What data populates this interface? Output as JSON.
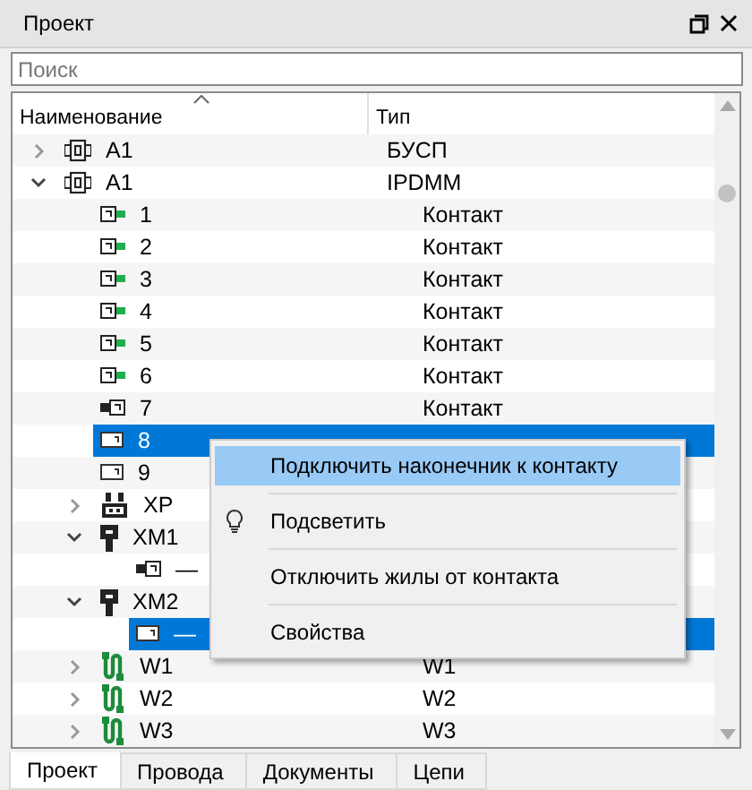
{
  "panel": {
    "title": "Проект"
  },
  "search": {
    "placeholder": "Поиск"
  },
  "columns": [
    "Наименование",
    "Тип"
  ],
  "rows": [
    {
      "name": "A1",
      "type": "БУСП",
      "kind": "device",
      "expanded": false,
      "selected": false
    },
    {
      "name": "A1",
      "type": "IPDMM",
      "kind": "device",
      "expanded": true,
      "selected": false,
      "children": [
        {
          "name": "1",
          "type": "Контакт",
          "kind": "contact-linked",
          "selected": false
        },
        {
          "name": "2",
          "type": "Контакт",
          "kind": "contact-linked",
          "selected": false
        },
        {
          "name": "3",
          "type": "Контакт",
          "kind": "contact-linked",
          "selected": false
        },
        {
          "name": "4",
          "type": "Контакт",
          "kind": "contact-linked",
          "selected": false
        },
        {
          "name": "5",
          "type": "Контакт",
          "kind": "contact-linked",
          "selected": false
        },
        {
          "name": "6",
          "type": "Контакт",
          "kind": "contact-linked",
          "selected": false
        },
        {
          "name": "7",
          "type": "Контакт",
          "kind": "contact-plugged",
          "selected": false
        },
        {
          "name": "8",
          "kind": "contact",
          "selected": true
        },
        {
          "name": "9",
          "kind": "contact",
          "selected": false
        },
        {
          "name": "XP",
          "kind": "connector",
          "expanded": false,
          "selected": false
        },
        {
          "name": "XM1",
          "kind": "plug",
          "expanded": true,
          "selected": false,
          "children": [
            {
              "name": "—",
              "kind": "contact-plugged",
              "selected": false
            }
          ]
        },
        {
          "name": "XM2",
          "kind": "plug",
          "expanded": true,
          "selected": false,
          "children": [
            {
              "name": "—",
              "kind": "contact",
              "selected": true
            }
          ]
        },
        {
          "name": "W1",
          "type": "W1",
          "kind": "cable",
          "expanded": false,
          "selected": false
        },
        {
          "name": "W2",
          "type": "W2",
          "kind": "cable",
          "expanded": false,
          "selected": false
        },
        {
          "name": "W3",
          "type": "W3",
          "kind": "cable",
          "expanded": false,
          "selected": false
        }
      ]
    }
  ],
  "context_menu": [
    {
      "label": "Подключить наконечник к контакту",
      "kind": "plain",
      "highlighted": true
    },
    {
      "label": "Подсветить",
      "kind": "bulb",
      "highlighted": false
    },
    {
      "label": "Отключить жилы от контакта",
      "kind": "plain",
      "highlighted": false
    },
    {
      "label": "Свойства",
      "kind": "plain",
      "highlighted": false
    }
  ],
  "tabs": [
    {
      "label": "Проект",
      "selected": true
    },
    {
      "label": "Провода",
      "selected": false
    },
    {
      "label": "Документы",
      "selected": false
    },
    {
      "label": "Цепи",
      "selected": false
    }
  ]
}
